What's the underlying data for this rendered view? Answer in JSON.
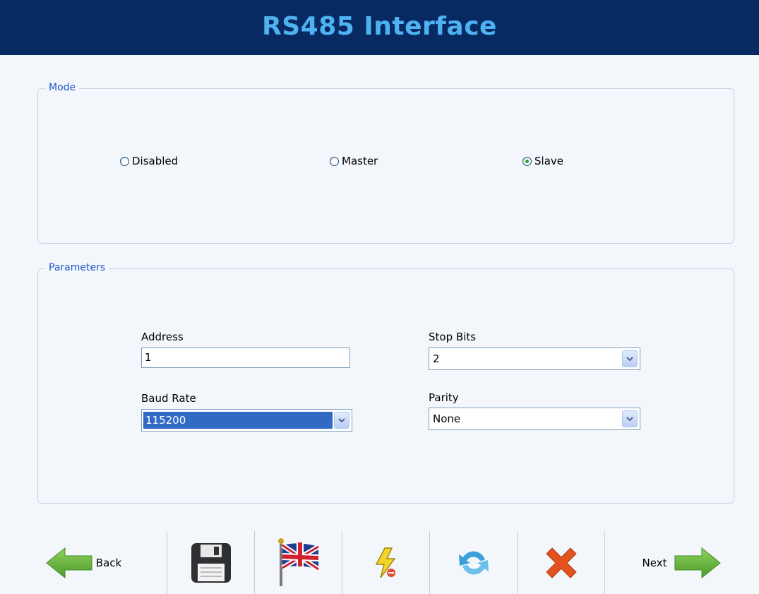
{
  "header": {
    "title": "RS485 Interface"
  },
  "mode": {
    "legend": "Mode",
    "options": [
      {
        "label": "Disabled",
        "checked": false
      },
      {
        "label": "Master",
        "checked": false
      },
      {
        "label": "Slave",
        "checked": true
      }
    ]
  },
  "parameters": {
    "legend": "Parameters",
    "address": {
      "label": "Address",
      "value": "1"
    },
    "baud_rate": {
      "label": "Baud Rate",
      "value": "115200"
    },
    "stop_bits": {
      "label": "Stop Bits",
      "value": "2"
    },
    "parity": {
      "label": "Parity",
      "value": "None"
    }
  },
  "toolbar": {
    "back_label": "Back",
    "next_label": "Next",
    "icons": [
      "back-arrow-icon",
      "save-icon",
      "uk-flag-icon",
      "power-icon",
      "refresh-icon",
      "cancel-icon",
      "next-arrow-icon"
    ]
  },
  "colors": {
    "header_bg": "#082a63",
    "title": "#4fb2f0",
    "legend": "#2257c7",
    "selection": "#316ac5",
    "arrow_green": "#5fb63a",
    "cancel_red": "#e2521f"
  }
}
